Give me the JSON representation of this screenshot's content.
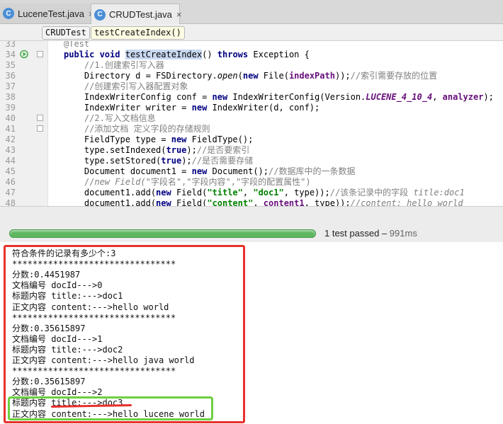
{
  "tabs": [
    {
      "label": "LuceneTest.java",
      "close": "×"
    },
    {
      "label": "CRUDTest.java",
      "close": "×"
    }
  ],
  "tab_icon_letter": "C",
  "breadcrumb": [
    "CRUDTest",
    "testCreateIndex()"
  ],
  "code_lines": [
    {
      "num": "33",
      "html": "<span class=\"cm\">@Test</span>"
    },
    {
      "num": "34",
      "html": "<span class=\"kw\">public void</span> <span class=\"hl\">testCreateIndex</span>() <span class=\"kw\">throws</span> Exception {"
    },
    {
      "num": "35",
      "html": "    <span class=\"cm\">//1.创建索引写入器</span>"
    },
    {
      "num": "36",
      "html": "    Directory d = FSDirectory.<span class=\"it\">open</span>(<span class=\"kw\">new</span> File(<span class=\"fld\">indexPath</span>));<span class=\"cm\">//索引需要存放的位置</span>"
    },
    {
      "num": "37",
      "html": "    <span class=\"cm\">//创建索引写入器配置对象</span>"
    },
    {
      "num": "38",
      "html": "    IndexWriterConfig conf = <span class=\"kw\">new</span> IndexWriterConfig(Version.<span class=\"fld it\">LUCENE_4_10_4</span>, <span class=\"fld\">analyzer</span>);"
    },
    {
      "num": "39",
      "html": "    IndexWriter writer = <span class=\"kw\">new</span> IndexWriter(d, conf);"
    },
    {
      "num": "40",
      "html": "    <span class=\"cm\">//2.写入文档信息</span>"
    },
    {
      "num": "41",
      "html": "    <span class=\"cm\">//添加文档 定义字段的存储规则</span>"
    },
    {
      "num": "42",
      "html": "    FieldType type = <span class=\"kw\">new</span> FieldType();"
    },
    {
      "num": "43",
      "html": "    type.setIndexed(<span class=\"kw\">true</span>);<span class=\"cm\">//是否要索引</span>"
    },
    {
      "num": "44",
      "html": "    type.setStored(<span class=\"kw\">true</span>);<span class=\"cm\">//是否需要存储</span>"
    },
    {
      "num": "45",
      "html": "    Document document1 = <span class=\"kw\">new</span> Document();<span class=\"cm\">//数据库中的一条数据</span>"
    },
    {
      "num": "46",
      "html": "    <span class=\"cm\">//<span class=\"it\">new Field(</span>\"字段名\",\"字段内容\",\"字段的配置属性\")</span>"
    },
    {
      "num": "47",
      "html": "    document1.add(<span class=\"kw\">new</span> Field(<span class=\"str\">\"title\"</span>, <span class=\"str\">\"doc1\"</span>, type));<span class=\"cm\">//该条记录中的字段 <span class=\"it\">title:doc1</span></span>"
    },
    {
      "num": "48",
      "html": "    document1.add(<span class=\"kw\">new</span> Field(<span class=\"str\">\"content\"</span>, <span class=\"fld\">content1</span>, type));<span class=\"cm it\">//content: hello world</span>"
    }
  ],
  "test_status": {
    "passed": "1 test passed",
    "sep": " – ",
    "duration": "991ms",
    "progress_fraction": 1.0
  },
  "console_lines": [
    "符合条件的记录有多少个:3",
    "********************************",
    "分数:0.4451987",
    "文档编号 docId--->0",
    "标题内容 title:--->doc1",
    "正文内容 content:--->hello world",
    "********************************",
    "分数:0.35615897",
    "文档编号 docId--->1",
    "标题内容 title:--->doc2",
    "正文内容 content:--->hello java world",
    "********************************",
    "分数:0.35615897",
    "文档编号 docId--->2",
    "标题内容 title:--->doc3",
    "正文内容 content:--->hello lucene world"
  ],
  "colors": {
    "accent_red": "#e8312d",
    "accent_green": "#6cd03f",
    "progress_green": "#5fb760"
  }
}
